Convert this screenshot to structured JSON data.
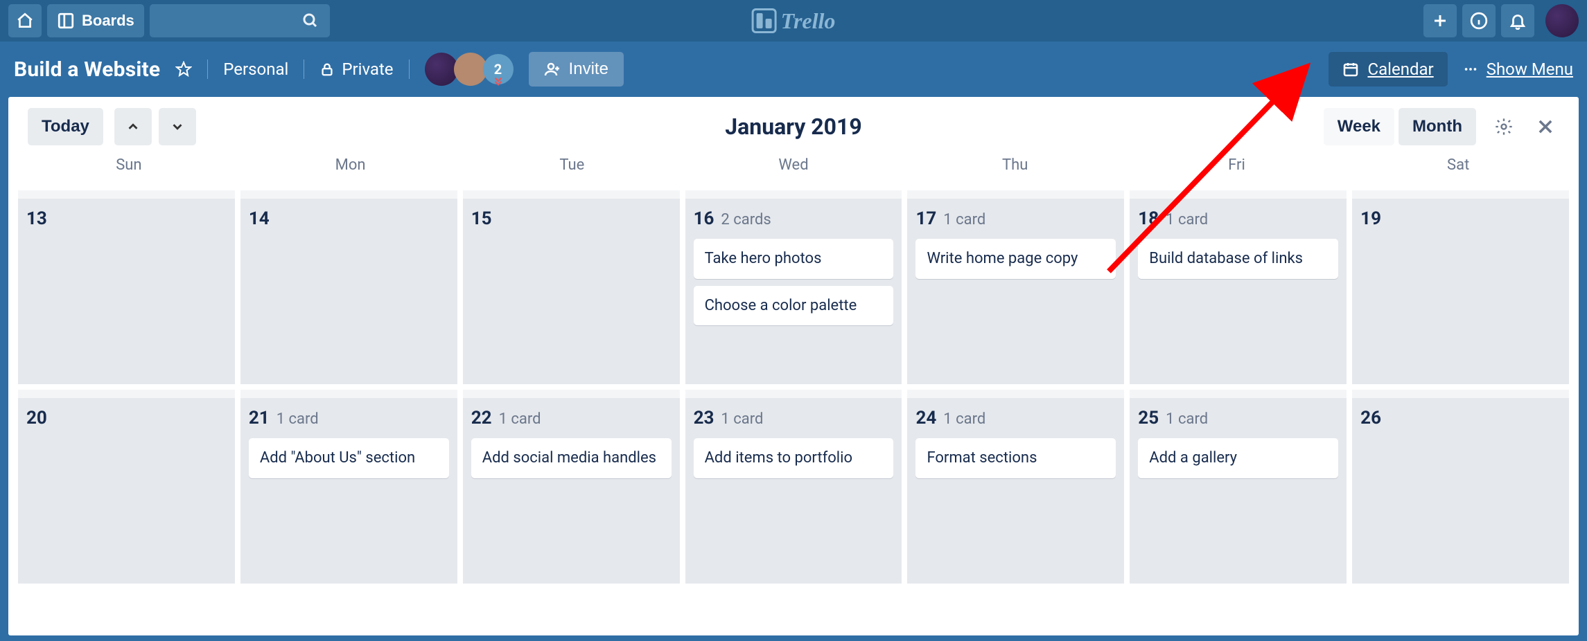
{
  "top_nav": {
    "boards_label": "Boards",
    "product_name": "Trello"
  },
  "board_header": {
    "title": "Build a Website",
    "personal_label": "Personal",
    "private_label": "Private",
    "member_extra_count": "2",
    "invite_label": "Invite",
    "calendar_label": "Calendar",
    "show_menu_label": "Show Menu"
  },
  "calendar": {
    "today_label": "Today",
    "title": "January 2019",
    "week_label": "Week",
    "month_label": "Month",
    "weekdays": [
      "Sun",
      "Mon",
      "Tue",
      "Wed",
      "Thu",
      "Fri",
      "Sat"
    ],
    "weeks": [
      {
        "days": [
          {
            "num": "13",
            "count": "",
            "cards": []
          },
          {
            "num": "14",
            "count": "",
            "cards": []
          },
          {
            "num": "15",
            "count": "",
            "cards": []
          },
          {
            "num": "16",
            "count": "2 cards",
            "cards": [
              "Take hero photos",
              "Choose a color palette"
            ]
          },
          {
            "num": "17",
            "count": "1 card",
            "cards": [
              "Write home page copy"
            ]
          },
          {
            "num": "18",
            "count": "1 card",
            "cards": [
              "Build database of links"
            ]
          },
          {
            "num": "19",
            "count": "",
            "cards": []
          }
        ]
      },
      {
        "days": [
          {
            "num": "20",
            "count": "",
            "cards": []
          },
          {
            "num": "21",
            "count": "1 card",
            "cards": [
              "Add \"About Us\" section"
            ]
          },
          {
            "num": "22",
            "count": "1 card",
            "cards": [
              "Add social media handles"
            ]
          },
          {
            "num": "23",
            "count": "1 card",
            "cards": [
              "Add items to portfolio"
            ]
          },
          {
            "num": "24",
            "count": "1 card",
            "cards": [
              "Format sections"
            ]
          },
          {
            "num": "25",
            "count": "1 card",
            "cards": [
              "Add a gallery"
            ]
          },
          {
            "num": "26",
            "count": "",
            "cards": []
          }
        ]
      }
    ]
  }
}
